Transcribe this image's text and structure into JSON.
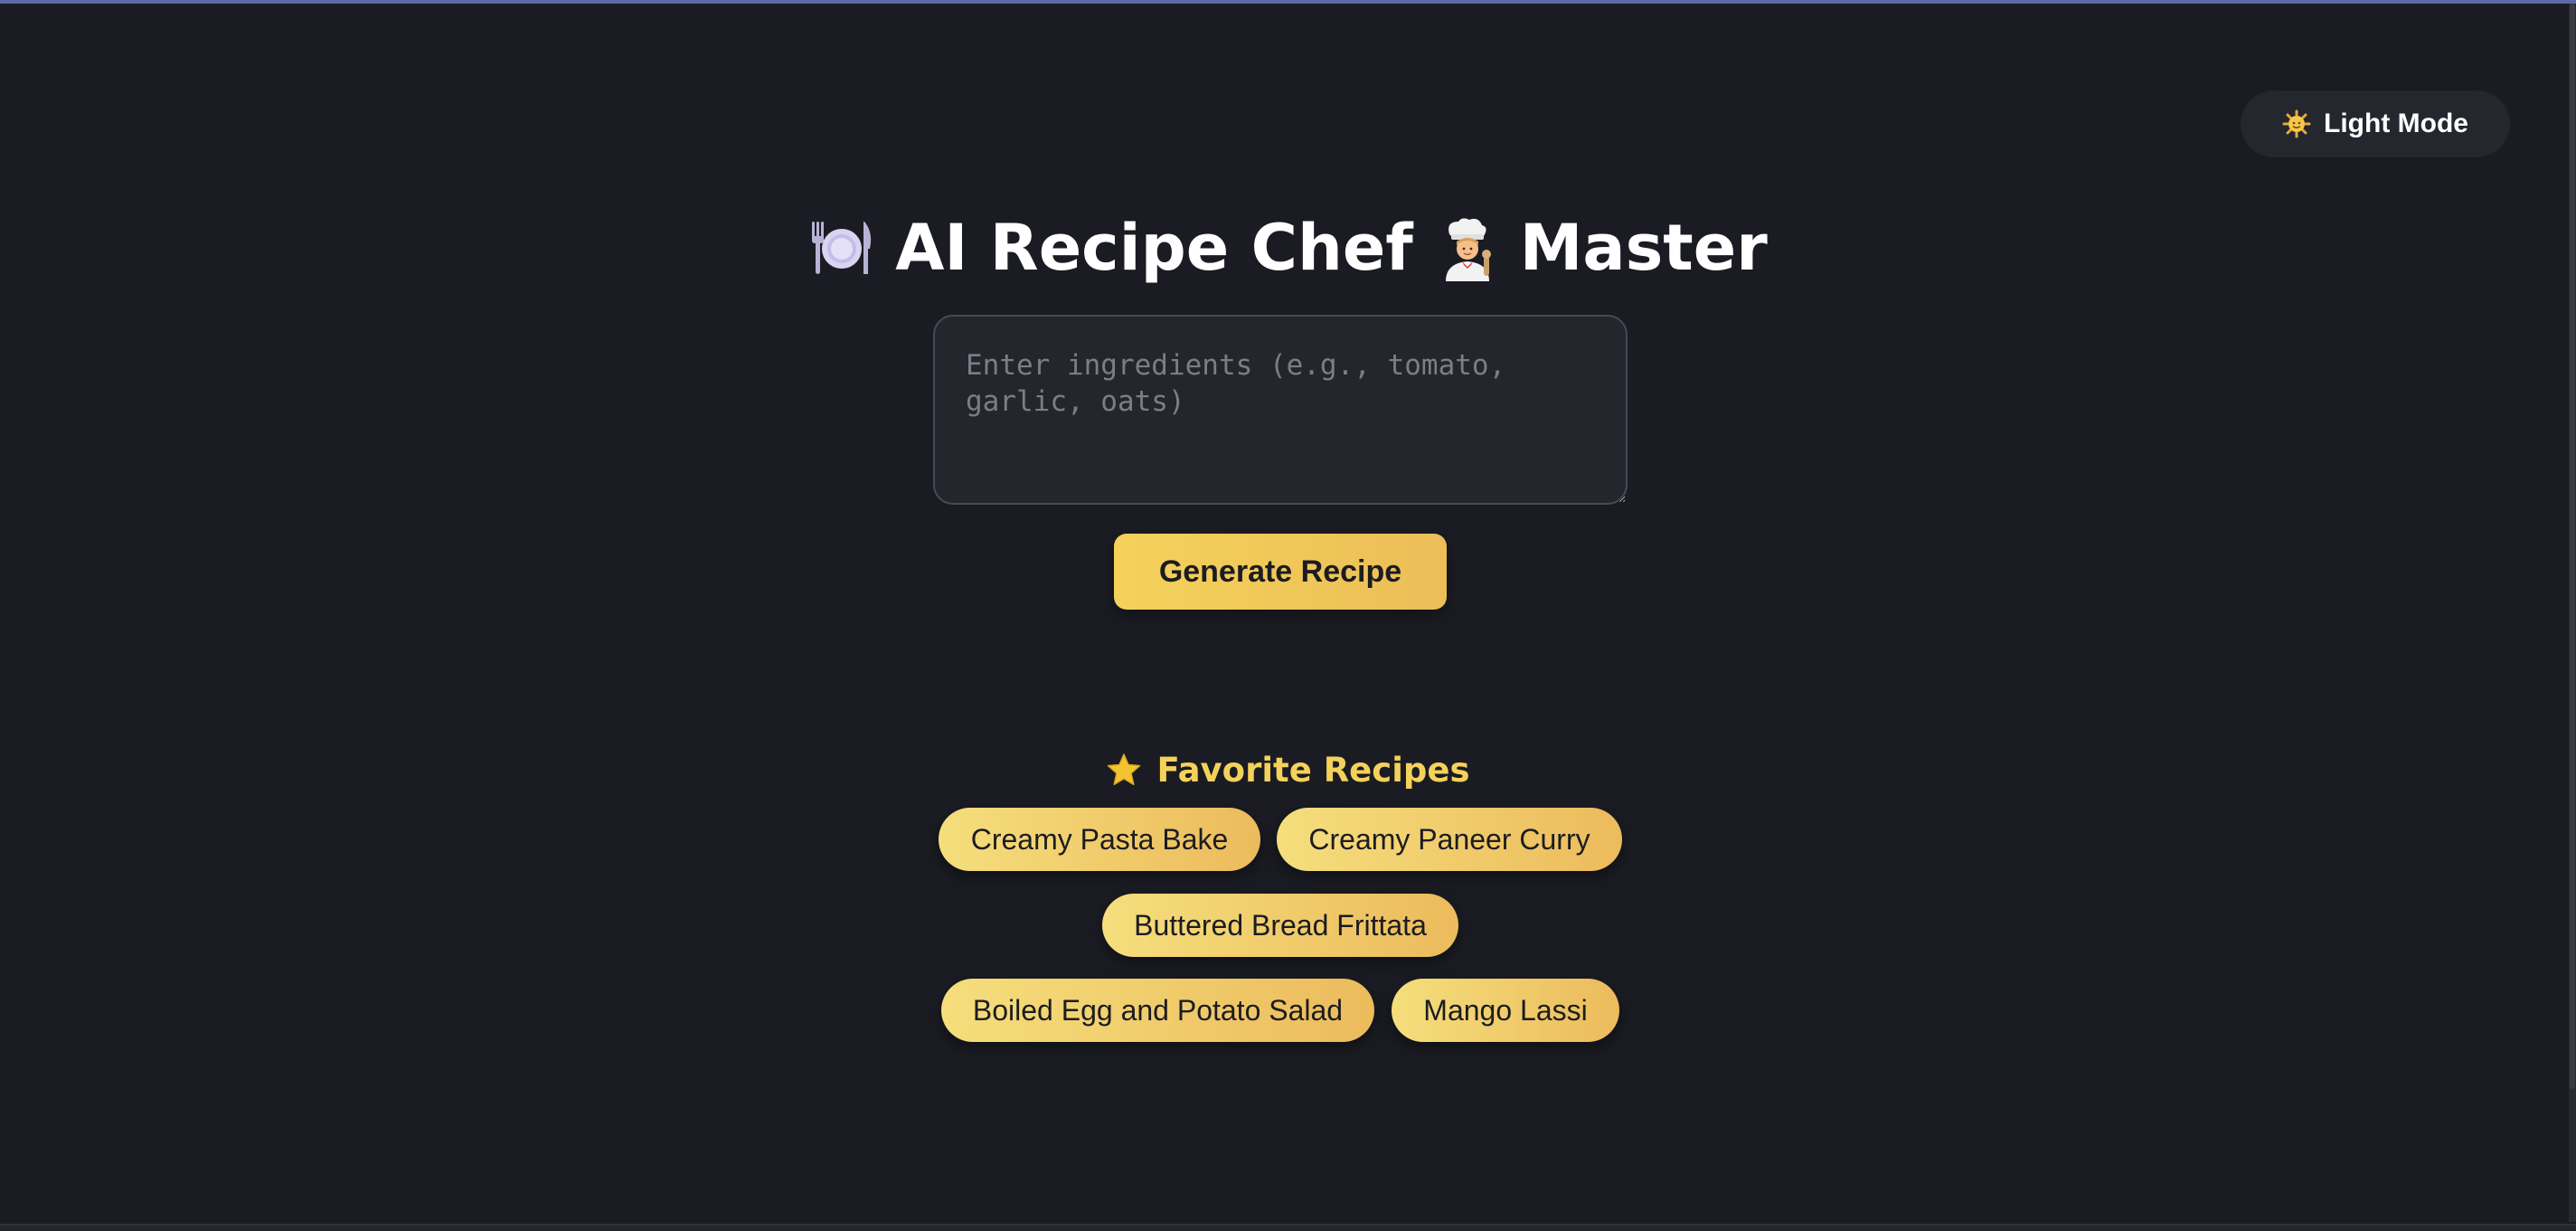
{
  "theme_toggle": {
    "icon": "sun-icon",
    "label": "Light Mode"
  },
  "header": {
    "title_icon": "plate-cutlery-icon",
    "title_part1": "AI Recipe Chef",
    "chef_icon": "chef-icon",
    "title_part2": "Master"
  },
  "ingredients": {
    "placeholder": "Enter ingredients (e.g., tomato, garlic, oats)",
    "value": ""
  },
  "generate_button": {
    "label": "Generate Recipe"
  },
  "favorites": {
    "icon": "star-icon",
    "heading": "Favorite Recipes",
    "items": [
      "Creamy Pasta Bake",
      "Creamy Paneer Curry",
      "Buttered Bread Frittata",
      "Boiled Egg and Potato Salad",
      "Mango Lassi"
    ]
  },
  "colors": {
    "background": "#1b1c23",
    "accent": "#f4d25a",
    "accent_end": "#ecbd58",
    "surface": "#25272e",
    "heading_text": "#ffffff"
  }
}
